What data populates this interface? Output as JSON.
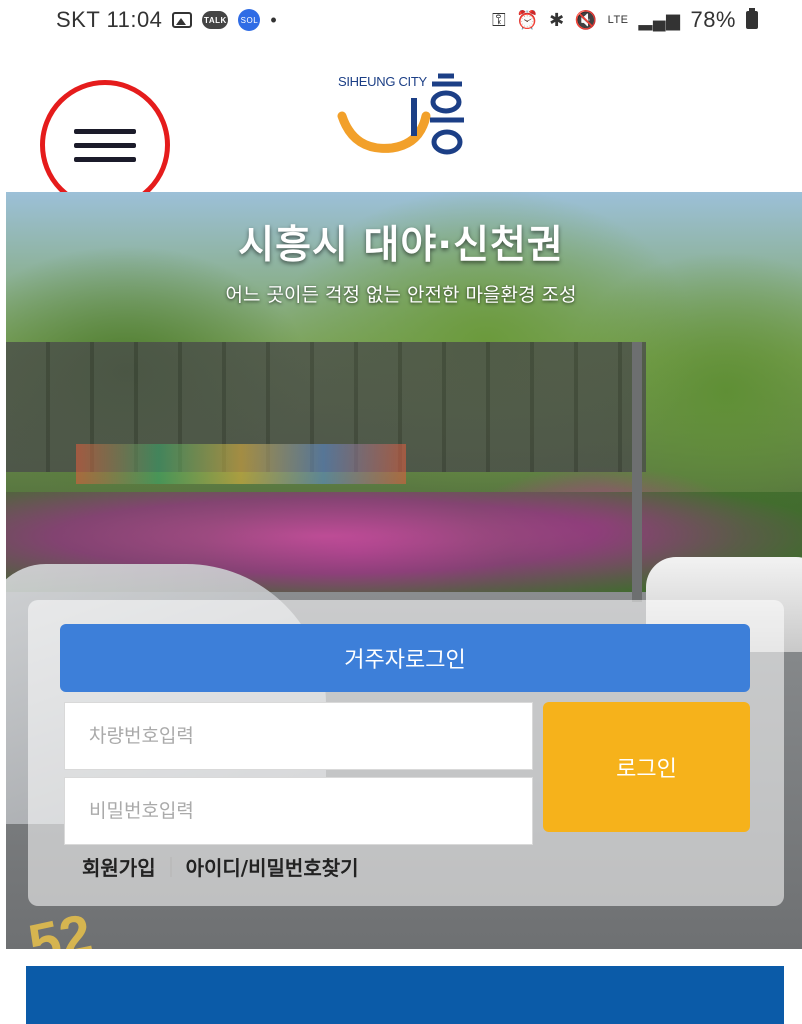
{
  "status_bar": {
    "carrier_time": "SKT 11:04",
    "network": "LTE",
    "battery": "78%"
  },
  "header": {
    "logo_text": "SIHEUNG CITY",
    "logo_word": "시흥",
    "colors": {
      "logo_blue": "#1c3f86",
      "logo_orange": "#f2a02a",
      "menu_circle": "#e51c1c"
    }
  },
  "hero": {
    "title": "시흥시 대야·신천권",
    "subtitle": "어느 곳이든 걱정 없는 안전한 마을환경 조성"
  },
  "login": {
    "header_label": "거주자로그인",
    "plate_placeholder": "차량번호입력",
    "password_placeholder": "비밀번호입력",
    "login_button": "로그인",
    "signup_link": "회원가입",
    "find_link": "아이디/비밀번호찾기",
    "colors": {
      "header": "#3d7fd9",
      "button": "#f6b21b"
    }
  },
  "footer": {
    "banner_color": "#0b5ba8"
  },
  "icons": [
    "hamburger-menu-icon",
    "gallery-icon",
    "kakaotalk-icon",
    "sol-pay-icon",
    "key-icon",
    "alarm-icon",
    "bluetooth-icon",
    "mute-icon",
    "lte-icon",
    "signal-icon",
    "battery-icon"
  ]
}
